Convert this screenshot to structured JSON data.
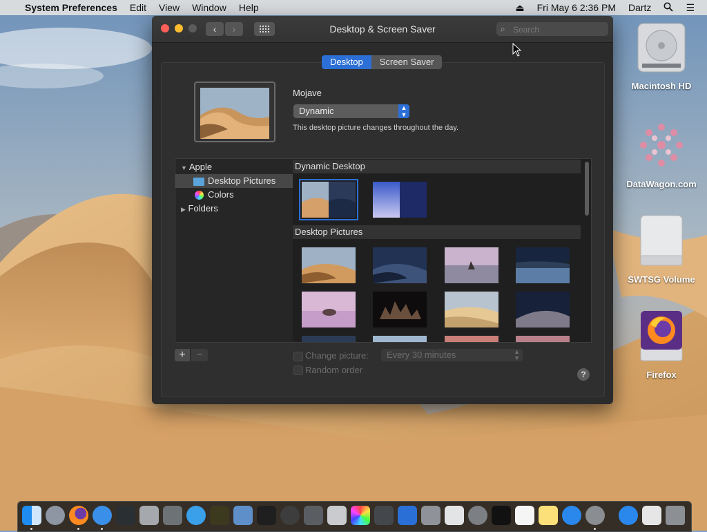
{
  "menubar": {
    "app_name": "System Preferences",
    "menus": [
      "Edit",
      "View",
      "Window",
      "Help"
    ],
    "clock": "Fri May 6  2:36 PM",
    "user": "Dartz"
  },
  "window": {
    "title": "Desktop & Screen Saver",
    "search_placeholder": "Search",
    "tabs": {
      "desktop": "Desktop",
      "screen_saver": "Screen Saver"
    },
    "picture_name": "Mojave",
    "dynamic_value": "Dynamic",
    "description": "This desktop picture changes throughout the day.",
    "source_list": {
      "apple": "Apple",
      "desktop_pictures": "Desktop Pictures",
      "colors": "Colors",
      "folders": "Folders"
    },
    "sections": {
      "dynamic": "Dynamic Desktop",
      "pictures": "Desktop Pictures"
    },
    "add_label": "+",
    "remove_label": "−",
    "change_picture_label": "Change picture:",
    "interval_value": "Every 30 minutes",
    "random_order_label": "Random order",
    "help_label": "?"
  },
  "desktop_icons": [
    {
      "label": "Macintosh HD"
    },
    {
      "label": "DataWagon.com"
    },
    {
      "label": "SWTSG Volume"
    },
    {
      "label": "Firefox"
    }
  ],
  "colors": {
    "accent": "#2c6fd6",
    "close": "#fc5f57",
    "minimize": "#fdbc2e"
  }
}
